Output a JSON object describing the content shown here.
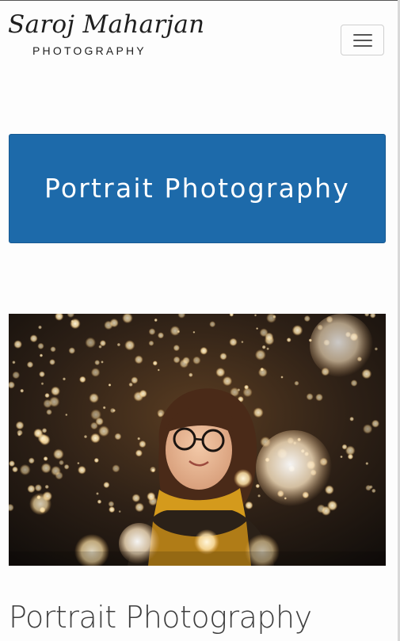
{
  "brand": {
    "script_name": "Saroj Maharjan",
    "subtitle": "PHOTOGRAPHY"
  },
  "nav": {
    "toggle_icon": "hamburger-icon"
  },
  "hero": {
    "title": "Portrait Photography",
    "background_color": "#1d6aaa"
  },
  "gallery": {
    "image_subject": "portrait-photo"
  },
  "section": {
    "heading": "Portrait Photography"
  }
}
